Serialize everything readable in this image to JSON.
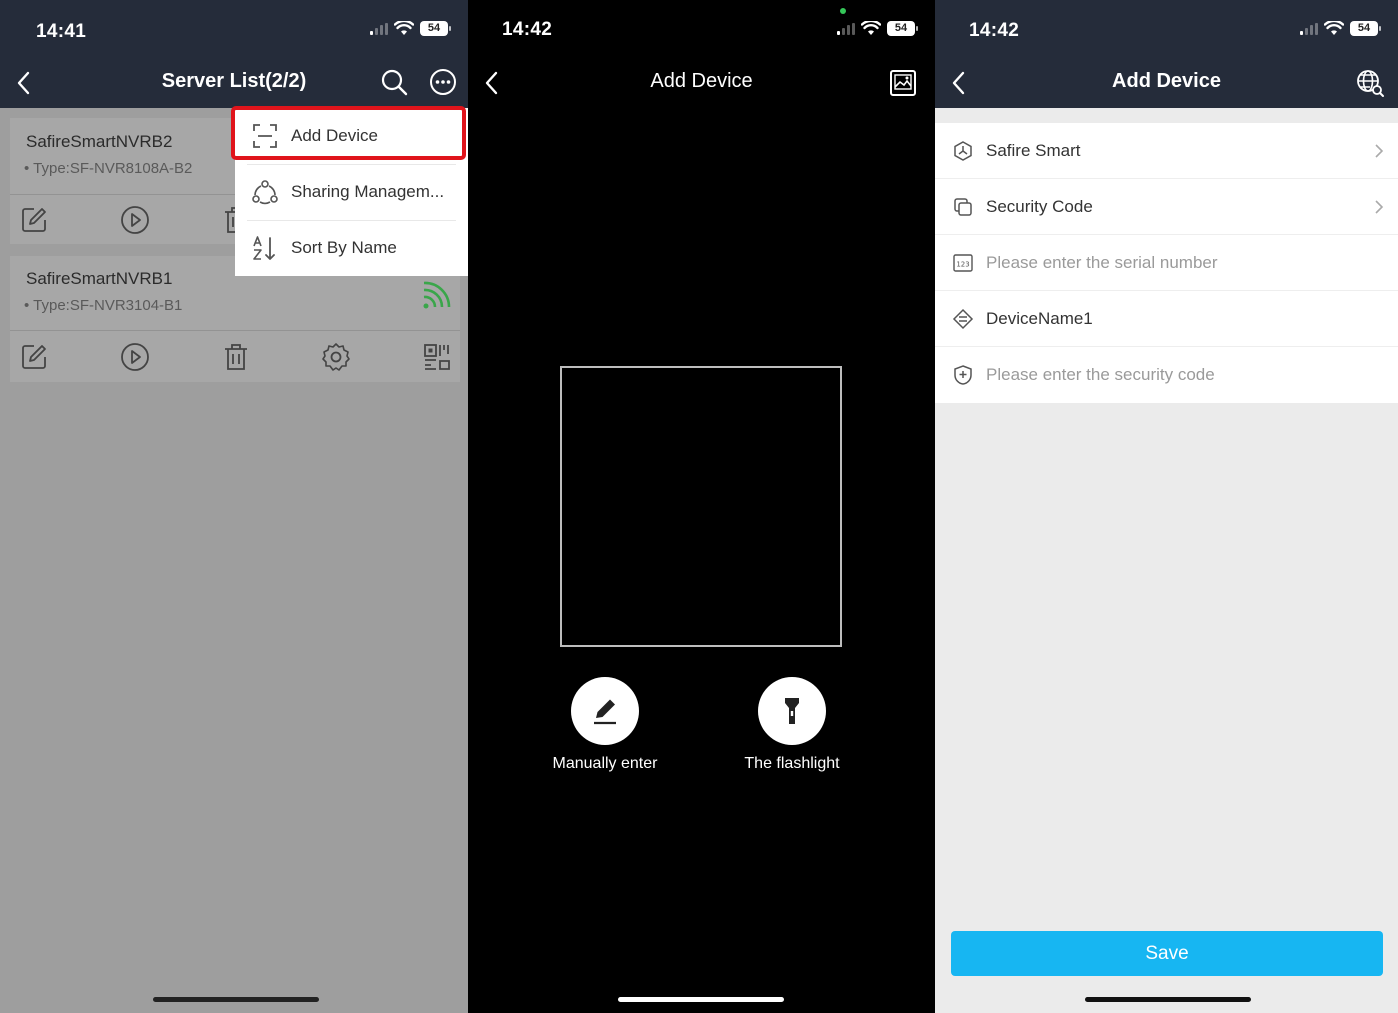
{
  "screen1": {
    "time": "14:41",
    "battery": "54",
    "title": "Server List(2/2)",
    "devices": [
      {
        "name": "SafireSmartNVRB2",
        "type": "• Type:SF-NVR8108A-B2"
      },
      {
        "name": "SafireSmartNVRB1",
        "type": "• Type:SF-NVR3104-B1"
      }
    ],
    "menu": {
      "add_device": "Add Device",
      "sharing": "Sharing Managem...",
      "sort": "Sort By Name"
    }
  },
  "screen2": {
    "time": "14:42",
    "battery": "54",
    "title": "Add Device",
    "manual_label": "Manually enter",
    "flashlight_label": "The flashlight"
  },
  "screen3": {
    "time": "14:42",
    "battery": "54",
    "title": "Add Device",
    "rows": {
      "brand": "Safire Smart",
      "security_code": "Security Code",
      "serial_placeholder": "Please enter the serial number",
      "device_name": "DeviceName1",
      "security_placeholder": "Please enter the security code"
    },
    "save_label": "Save"
  },
  "colors": {
    "navbar": "#252c3a",
    "highlight": "#e0141b",
    "save_button": "#17b6f2",
    "signal_green": "#3aa64a"
  }
}
